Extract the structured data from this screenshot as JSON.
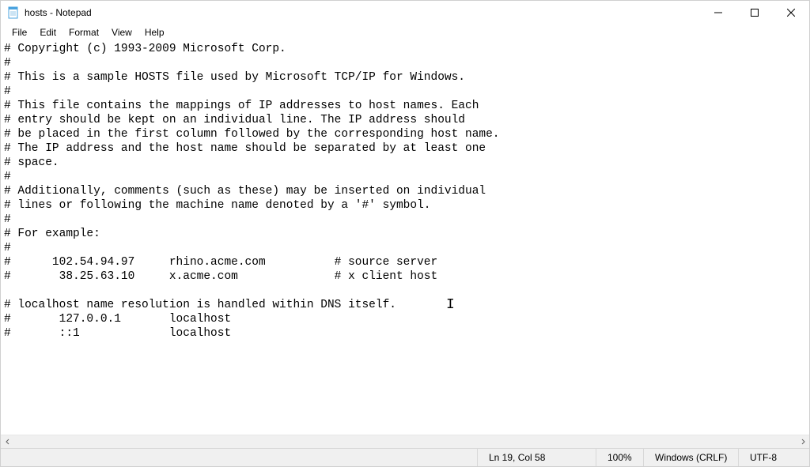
{
  "titlebar": {
    "title": "hosts - Notepad"
  },
  "menu": {
    "file": "File",
    "edit": "Edit",
    "format": "Format",
    "view": "View",
    "help": "Help"
  },
  "content": "# Copyright (c) 1993-2009 Microsoft Corp.\n#\n# This is a sample HOSTS file used by Microsoft TCP/IP for Windows.\n#\n# This file contains the mappings of IP addresses to host names. Each\n# entry should be kept on an individual line. The IP address should\n# be placed in the first column followed by the corresponding host name.\n# The IP address and the host name should be separated by at least one\n# space.\n#\n# Additionally, comments (such as these) may be inserted on individual\n# lines or following the machine name denoted by a '#' symbol.\n#\n# For example:\n#\n#      102.54.94.97     rhino.acme.com          # source server\n#       38.25.63.10     x.acme.com              # x client host\n\n# localhost name resolution is handled within DNS itself.\n#       127.0.0.1       localhost\n#       ::1             localhost",
  "statusbar": {
    "position": "Ln 19, Col 58",
    "zoom": "100%",
    "line_ending": "Windows (CRLF)",
    "encoding": "UTF-8"
  }
}
